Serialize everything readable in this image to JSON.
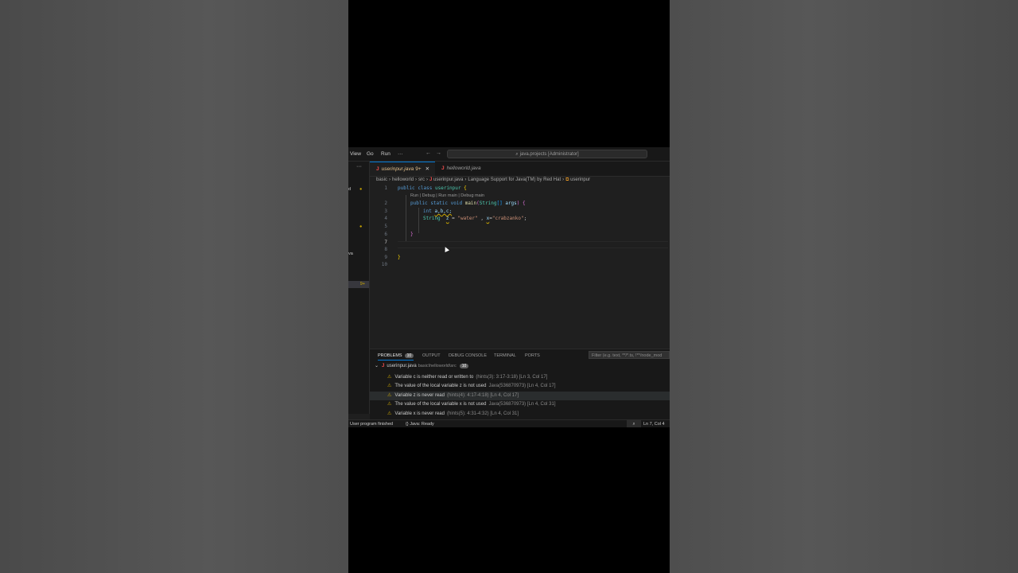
{
  "titlebar": {
    "menus": [
      "View",
      "Go",
      "Run",
      "···"
    ],
    "search_text": "java.projects [Administrator]"
  },
  "sidebar": {
    "fragments": [
      "d",
      "va"
    ],
    "badge": "9+"
  },
  "tabs": [
    {
      "label": "userinpur.java",
      "badge": "9+",
      "active": true
    },
    {
      "label": "helloworld.java",
      "active": false
    }
  ],
  "breadcrumb": [
    "basic",
    "helloworld",
    "src",
    "userinpur.java",
    "Language Support for Java(TM) by Red Hat",
    "userinpur"
  ],
  "editor": {
    "line_numbers": [
      "1",
      "2",
      "3",
      "4",
      "5",
      "6",
      "7",
      "8",
      "9",
      "10"
    ],
    "codelens": "Run | Debug | Run main | Debug main",
    "lines": {
      "l1": [
        "public",
        "class",
        "userinpur",
        "{"
      ],
      "l2": [
        "public",
        "static",
        "void",
        "main",
        "(",
        "String",
        "[]",
        "args",
        ")",
        "{"
      ],
      "l3": [
        "int",
        "a,b,c;"
      ],
      "l4": [
        "String",
        "z",
        "=",
        "\"water\"",
        ",",
        "x",
        "=",
        "\"crabzanko\"",
        ";"
      ],
      "l6": "}",
      "l9": "}"
    }
  },
  "panel": {
    "tabs": [
      {
        "label": "PROBLEMS",
        "count": "10",
        "active": true
      },
      {
        "label": "OUTPUT"
      },
      {
        "label": "DEBUG CONSOLE"
      },
      {
        "label": "TERMINAL"
      },
      {
        "label": "PORTS"
      }
    ],
    "filter_placeholder": "Filter (e.g. text, **/*.ts, !**/node_mod",
    "group": {
      "file": "userinpur.java",
      "path": "basic\\helloworld\\src",
      "count": "10"
    },
    "problems": [
      {
        "msg": "Variable c is neither read or written to",
        "src": "(hints(3): 3:17-3:18)  [Ln 3, Col 17]"
      },
      {
        "msg": "The value of the local variable z is not used",
        "src": "Java(536870973)  [Ln 4, Col 17]"
      },
      {
        "msg": "Variable z is never read",
        "src": "(hints(4): 4:17-4:18)  [Ln 4, Col 17]"
      },
      {
        "msg": "The value of the local variable x is not used",
        "src": "Java(536870973)  [Ln 4, Col 31]"
      },
      {
        "msg": "Variable x is never read",
        "src": "(hints(5): 4:31-4:32)  [Ln 4, Col 31]"
      }
    ]
  },
  "statusbar": {
    "left": "User program finished",
    "java": "Java: Ready",
    "position": "Ln 7, Col 4"
  },
  "colors": {
    "accent": "#0078d4",
    "warning": "#cca700",
    "java_icon": "#f14c4c"
  }
}
